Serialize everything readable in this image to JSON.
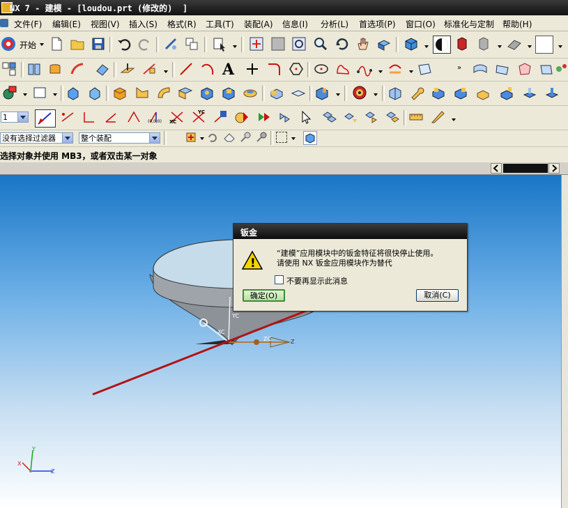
{
  "window": {
    "title": "NX 7 - 建模 - [loudou.prt (修改的)  ]"
  },
  "menu": [
    {
      "label": "文件(F)"
    },
    {
      "label": "编辑(E)"
    },
    {
      "label": "视图(V)"
    },
    {
      "label": "插入(S)"
    },
    {
      "label": "格式(R)"
    },
    {
      "label": "工具(T)"
    },
    {
      "label": "装配(A)"
    },
    {
      "label": "信息(I)"
    },
    {
      "label": "分析(L)"
    },
    {
      "label": "首选项(P)"
    },
    {
      "label": "窗口(O)"
    },
    {
      "label": "标准化与定制"
    },
    {
      "label": "帮助(H)"
    }
  ],
  "toolbar": {
    "start_label": "开始",
    "layer_value": "1",
    "filter_value": "没有选择过滤器",
    "assembly_value": "整个装配"
  },
  "cue_line": "选择对象并使用 MB3，或者双击某一对象",
  "viewport": {
    "main_triad": {
      "xc": "XC",
      "yc": "YC",
      "zc": "ZC",
      "z": "Z"
    },
    "corner_triad": {
      "x": "X",
      "y": "Y",
      "z": "Z"
    }
  },
  "dialog": {
    "title": "钣金",
    "message_line1": "“建模”应用模块中的钣金特征将很快停止使用。",
    "message_line2": "请使用 NX 钣金应用模块作为替代",
    "checkbox_label": "不要再显示此消息",
    "ok_label": "确定(O)",
    "cancel_label": "取消(C)"
  },
  "colors": {
    "annotation_arrow": "#b01414",
    "viewport_top": "#1976c6"
  }
}
